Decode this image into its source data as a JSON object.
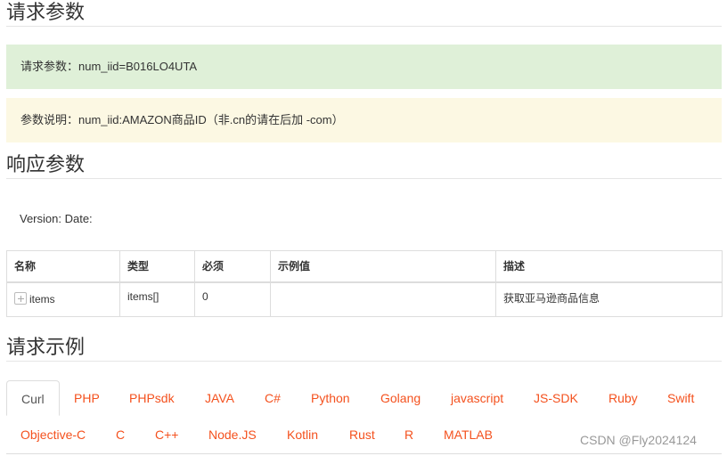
{
  "sections": {
    "request_params_title": "请求参数",
    "response_params_title": "响应参数",
    "request_example_title": "请求示例"
  },
  "request": {
    "params_text": "请求参数：num_iid=B016LO4UTA",
    "description_text": "参数说明：num_iid:AMAZON商品ID（非.cn的请在后加 -com）"
  },
  "response": {
    "version_text": "Version: Date:",
    "table": {
      "headers": [
        "名称",
        "类型",
        "必须",
        "示例值",
        "描述"
      ],
      "rows": [
        {
          "name": "items",
          "type": "items[]",
          "required": "0",
          "example": "",
          "description": "获取亚马逊商品信息",
          "icon": "expand-plus-icon"
        }
      ]
    }
  },
  "example_tabs": {
    "active": "Curl",
    "items": [
      "Curl",
      "PHP",
      "PHPsdk",
      "JAVA",
      "C#",
      "Python",
      "Golang",
      "javascript",
      "JS-SDK",
      "Ruby",
      "Swift",
      "Objective-C",
      "C",
      "C++",
      "Node.JS",
      "Kotlin",
      "Rust",
      "R",
      "MATLAB"
    ]
  },
  "watermark": "CSDN @Fly2024124",
  "colors": {
    "success_bg": "#dff0d8",
    "warning_bg": "#fcf8e3",
    "tab_link": "#f4511e",
    "tab_active": "#555555"
  }
}
